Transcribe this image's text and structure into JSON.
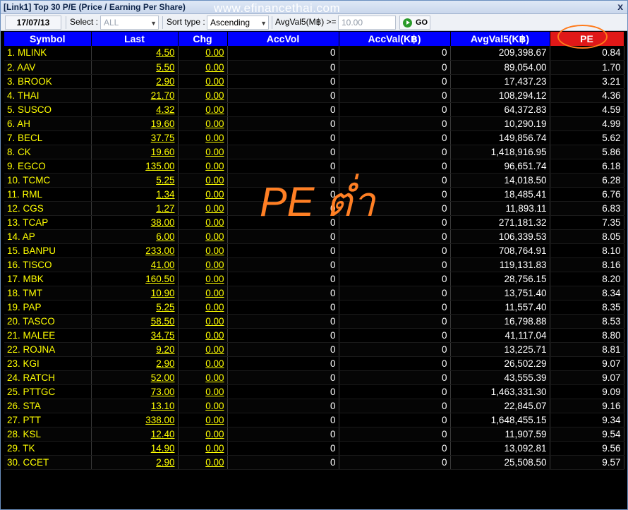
{
  "window": {
    "title": "[Link1] Top 30 P/E (Price / Earning Per Share)",
    "close_label": "x",
    "watermark": "www.efinancethai.com"
  },
  "toolbar": {
    "date": "17/07/13",
    "select_label": "Select :",
    "select_value": "ALL",
    "sort_label": "Sort type :",
    "sort_value": "Ascending",
    "avgval_label": "AvgVal5(M฿) >=",
    "avgval_value": "10.00",
    "go_label": "GO"
  },
  "annotation": "PE ต่ำ",
  "columns": [
    "Symbol",
    "Last",
    "Chg",
    "AccVol",
    "AccVal(K฿)",
    "AvgVal5(K฿)",
    "PE"
  ],
  "rows": [
    {
      "symbol": "1. MLINK",
      "last": "4.50",
      "chg": "0.00",
      "accvol": "0",
      "accval": "0",
      "avgval5": "209,398.67",
      "pe": "0.84"
    },
    {
      "symbol": "2. AAV",
      "last": "5.50",
      "chg": "0.00",
      "accvol": "0",
      "accval": "0",
      "avgval5": "89,054.00",
      "pe": "1.70"
    },
    {
      "symbol": "3. BROOK",
      "last": "2.90",
      "chg": "0.00",
      "accvol": "0",
      "accval": "0",
      "avgval5": "17,437.23",
      "pe": "3.21"
    },
    {
      "symbol": "4. THAI",
      "last": "21.70",
      "chg": "0.00",
      "accvol": "0",
      "accval": "0",
      "avgval5": "108,294.12",
      "pe": "4.36"
    },
    {
      "symbol": "5. SUSCO",
      "last": "4.32",
      "chg": "0.00",
      "accvol": "0",
      "accval": "0",
      "avgval5": "64,372.83",
      "pe": "4.59"
    },
    {
      "symbol": "6. AH",
      "last": "19.60",
      "chg": "0.00",
      "accvol": "0",
      "accval": "0",
      "avgval5": "10,290.19",
      "pe": "4.99"
    },
    {
      "symbol": "7. BECL",
      "last": "37.75",
      "chg": "0.00",
      "accvol": "0",
      "accval": "0",
      "avgval5": "149,856.74",
      "pe": "5.62"
    },
    {
      "symbol": "8. CK",
      "last": "19.60",
      "chg": "0.00",
      "accvol": "0",
      "accval": "0",
      "avgval5": "1,418,916.95",
      "pe": "5.86"
    },
    {
      "symbol": "9. EGCO",
      "last": "135.00",
      "chg": "0.00",
      "accvol": "0",
      "accval": "0",
      "avgval5": "96,651.74",
      "pe": "6.18"
    },
    {
      "symbol": "10. TCMC",
      "last": "5.25",
      "chg": "0.00",
      "accvol": "0",
      "accval": "0",
      "avgval5": "14,018.50",
      "pe": "6.28"
    },
    {
      "symbol": "11. RML",
      "last": "1.34",
      "chg": "0.00",
      "accvol": "0",
      "accval": "0",
      "avgval5": "18,485.41",
      "pe": "6.76"
    },
    {
      "symbol": "12. CGS",
      "last": "1.27",
      "chg": "0.00",
      "accvol": "0",
      "accval": "0",
      "avgval5": "11,893.11",
      "pe": "6.83"
    },
    {
      "symbol": "13. TCAP",
      "last": "38.00",
      "chg": "0.00",
      "accvol": "0",
      "accval": "0",
      "avgval5": "271,181.32",
      "pe": "7.35"
    },
    {
      "symbol": "14. AP",
      "last": "6.00",
      "chg": "0.00",
      "accvol": "0",
      "accval": "0",
      "avgval5": "106,339.53",
      "pe": "8.05"
    },
    {
      "symbol": "15. BANPU",
      "last": "233.00",
      "chg": "0.00",
      "accvol": "0",
      "accval": "0",
      "avgval5": "708,764.91",
      "pe": "8.10"
    },
    {
      "symbol": "16. TISCO",
      "last": "41.00",
      "chg": "0.00",
      "accvol": "0",
      "accval": "0",
      "avgval5": "119,131.83",
      "pe": "8.16"
    },
    {
      "symbol": "17. MBK",
      "last": "160.50",
      "chg": "0.00",
      "accvol": "0",
      "accval": "0",
      "avgval5": "28,756.15",
      "pe": "8.20"
    },
    {
      "symbol": "18. TMT",
      "last": "10.90",
      "chg": "0.00",
      "accvol": "0",
      "accval": "0",
      "avgval5": "13,751.40",
      "pe": "8.34"
    },
    {
      "symbol": "19. PAP",
      "last": "5.25",
      "chg": "0.00",
      "accvol": "0",
      "accval": "0",
      "avgval5": "11,557.40",
      "pe": "8.35"
    },
    {
      "symbol": "20. TASCO",
      "last": "58.50",
      "chg": "0.00",
      "accvol": "0",
      "accval": "0",
      "avgval5": "16,798.88",
      "pe": "8.53"
    },
    {
      "symbol": "21. MALEE",
      "last": "34.75",
      "chg": "0.00",
      "accvol": "0",
      "accval": "0",
      "avgval5": "41,117.04",
      "pe": "8.80"
    },
    {
      "symbol": "22. ROJNA",
      "last": "9.20",
      "chg": "0.00",
      "accvol": "0",
      "accval": "0",
      "avgval5": "13,225.71",
      "pe": "8.81"
    },
    {
      "symbol": "23. KGI",
      "last": "2.90",
      "chg": "0.00",
      "accvol": "0",
      "accval": "0",
      "avgval5": "26,502.29",
      "pe": "9.07"
    },
    {
      "symbol": "24. RATCH",
      "last": "52.00",
      "chg": "0.00",
      "accvol": "0",
      "accval": "0",
      "avgval5": "43,555.39",
      "pe": "9.07"
    },
    {
      "symbol": "25. PTTGC",
      "last": "73.00",
      "chg": "0.00",
      "accvol": "0",
      "accval": "0",
      "avgval5": "1,463,331.30",
      "pe": "9.09"
    },
    {
      "symbol": "26. STA",
      "last": "13.10",
      "chg": "0.00",
      "accvol": "0",
      "accval": "0",
      "avgval5": "22,845.07",
      "pe": "9.16"
    },
    {
      "symbol": "27. PTT",
      "last": "338.00",
      "chg": "0.00",
      "accvol": "0",
      "accval": "0",
      "avgval5": "1,648,455.15",
      "pe": "9.34"
    },
    {
      "symbol": "28. KSL",
      "last": "12.40",
      "chg": "0.00",
      "accvol": "0",
      "accval": "0",
      "avgval5": "11,907.59",
      "pe": "9.54"
    },
    {
      "symbol": "29. TK",
      "last": "14.90",
      "chg": "0.00",
      "accvol": "0",
      "accval": "0",
      "avgval5": "13,092.81",
      "pe": "9.56"
    },
    {
      "symbol": "30. CCET",
      "last": "2.90",
      "chg": "0.00",
      "accvol": "0",
      "accval": "0",
      "avgval5": "25,508.50",
      "pe": "9.57"
    }
  ]
}
